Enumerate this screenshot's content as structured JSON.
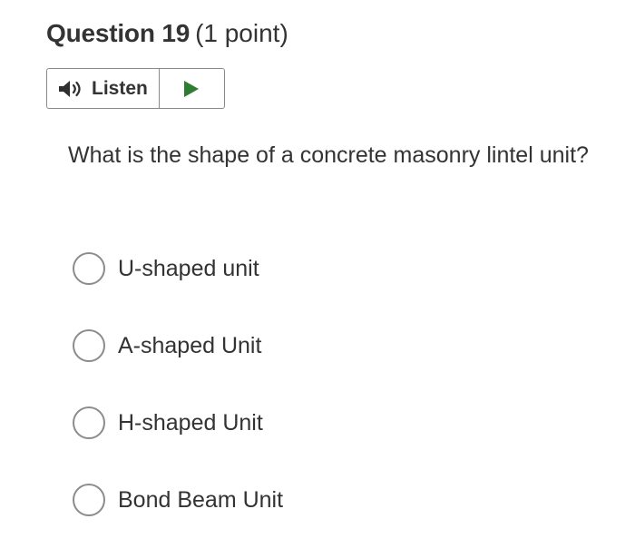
{
  "question": {
    "title": "Question 19",
    "points": "(1 point)",
    "text": "What is the shape of a concrete masonry lintel unit?"
  },
  "listen": {
    "label": "Listen",
    "speaker_icon": "speaker-icon",
    "play_icon": "play-icon",
    "play_color": "#2e7d32"
  },
  "options": [
    {
      "label": "U-shaped unit",
      "selected": false
    },
    {
      "label": "A-shaped Unit",
      "selected": false
    },
    {
      "label": "H-shaped Unit",
      "selected": false
    },
    {
      "label": "Bond Beam Unit",
      "selected": false
    }
  ]
}
